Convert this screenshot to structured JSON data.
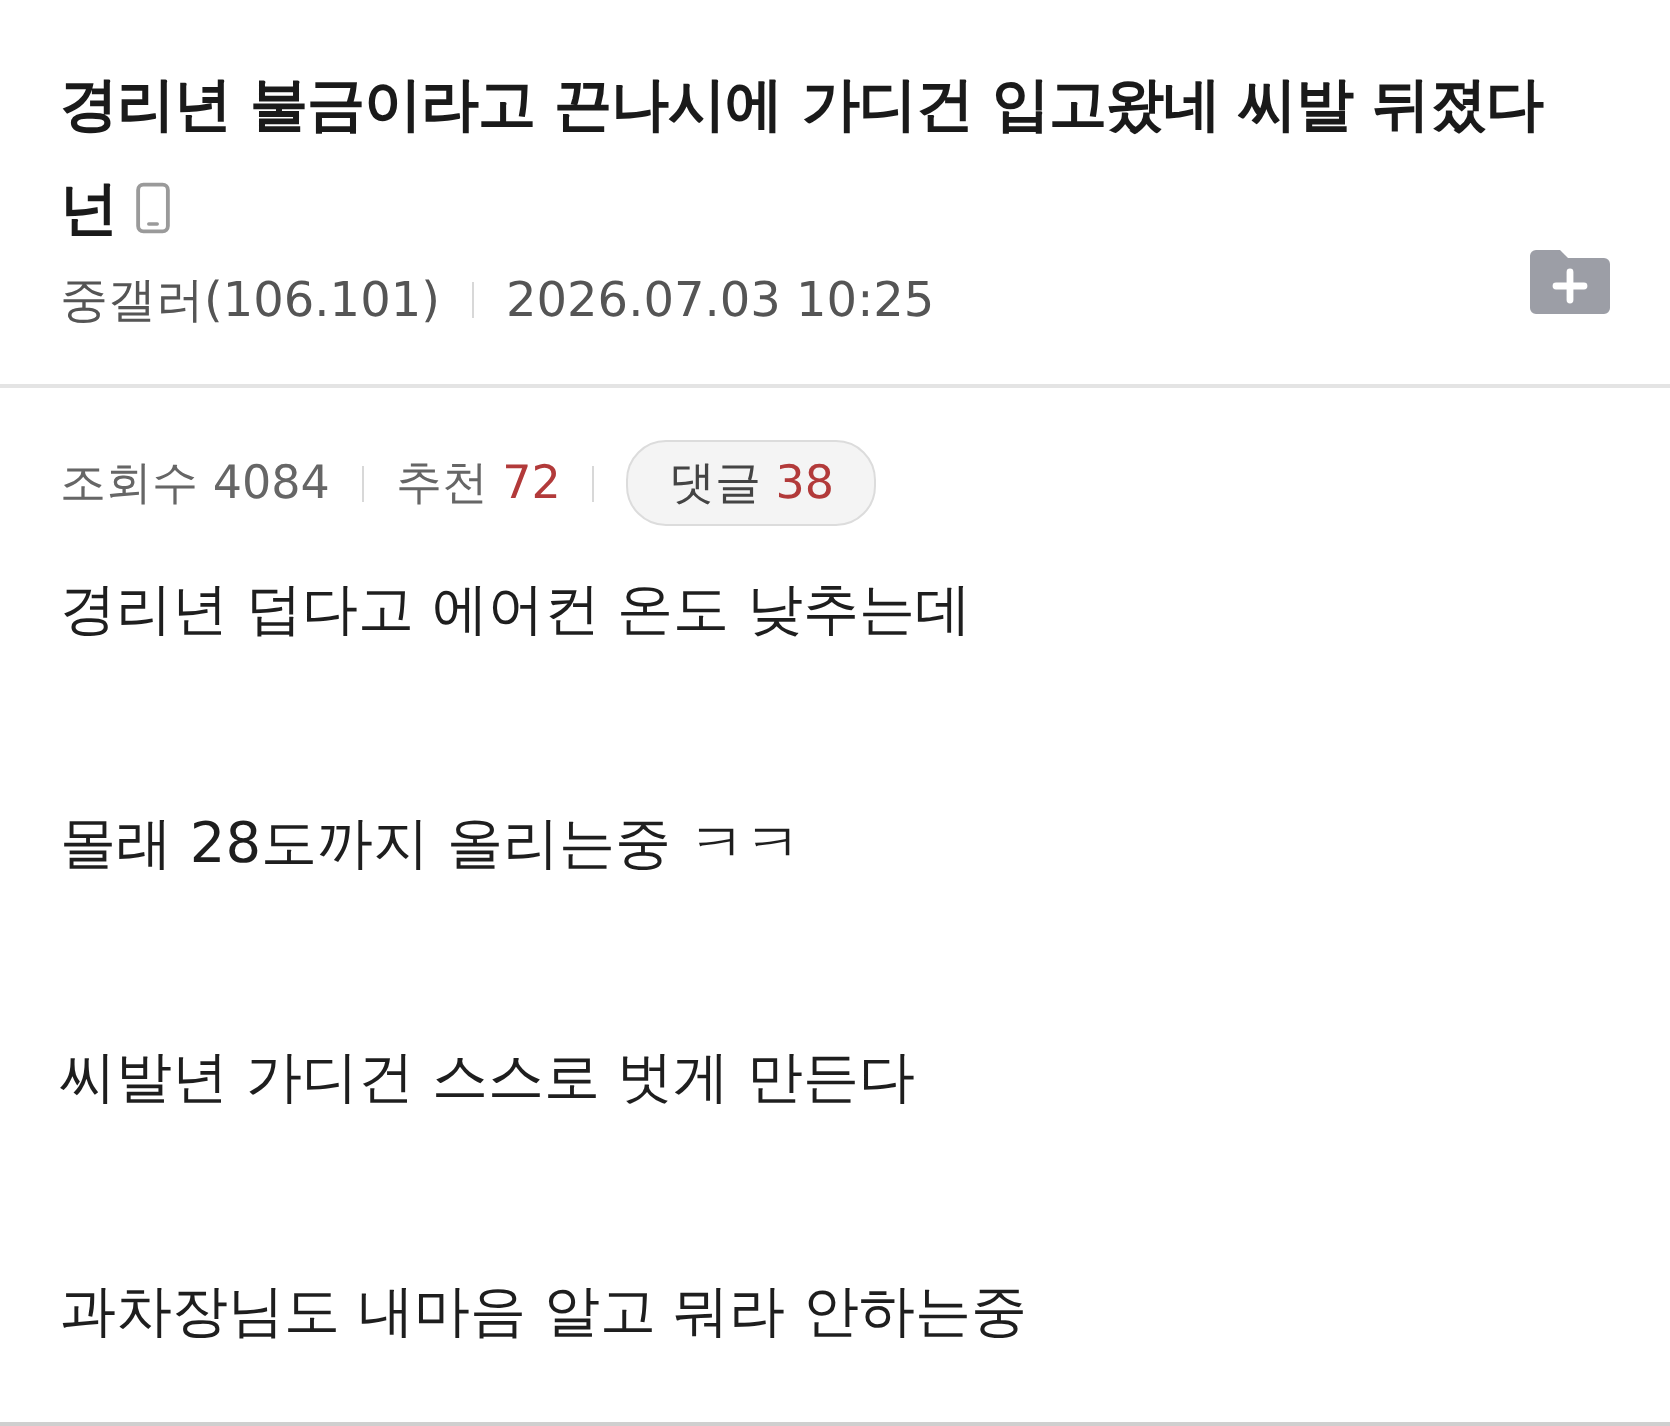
{
  "post": {
    "title": "경리년 불금이라고 끈나시에 가디건 입고왔네 씨발 뒤졌다 넌",
    "mobile_post": true,
    "author": "중갤러(106.101)",
    "date": "2026.07.03 10:25"
  },
  "stats": [
    {
      "label": "조회수",
      "value": "4084",
      "highlight": false
    },
    {
      "label": "추천",
      "value": "72",
      "highlight": true
    }
  ],
  "comments": {
    "label": "댓글",
    "value": "38"
  },
  "body": [
    "경리년 덥다고 에어컨 온도 낮추는데",
    "몰래 28도까지 올리는중 ㅋㅋ",
    "씨발년 가디건 스스로 벗게 만든다",
    "과차장님도 내마음 알고 뭐라 안하는중"
  ]
}
